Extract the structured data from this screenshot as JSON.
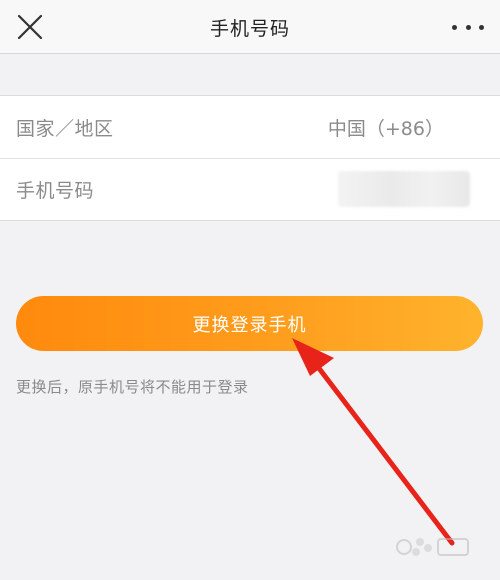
{
  "navbar": {
    "title": "手机号码",
    "close_icon": "close-icon",
    "more_icon": "more-dots-icon"
  },
  "form": {
    "rows": [
      {
        "label": "国家／地区",
        "value": "中国（+86）"
      },
      {
        "label": "手机号码",
        "value": ""
      }
    ]
  },
  "actions": {
    "change_button_label": "更换登录手机"
  },
  "hint": "更换后，原手机号将不能用于登录",
  "colors": {
    "accent_start": "#ff8a0d",
    "accent_end": "#ffb32d",
    "arrow": "#e8231a",
    "background": "#f2f1f3"
  }
}
